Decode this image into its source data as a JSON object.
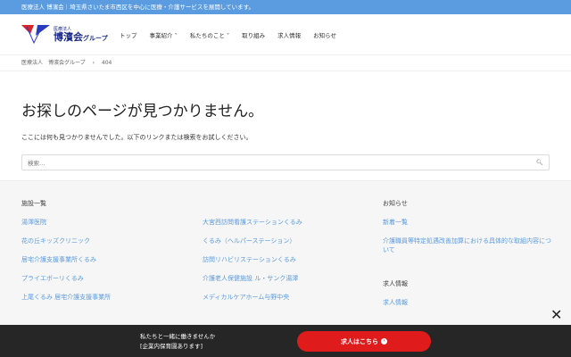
{
  "topbar": "医療法人 博濱会｜埼玉県さいたま市西区を中心に医療・介護サービスを展開しています。",
  "logo": {
    "small": "医療法人",
    "main": "博濱会",
    "suffix": "グループ"
  },
  "nav": [
    "トップ",
    "事業紹介",
    "私たちのこと",
    "取り組み",
    "求人情報",
    "お知らせ"
  ],
  "breadcrumb": {
    "home": "医療法人　博濱会グループ",
    "sep": "›",
    "current": "404"
  },
  "title": "お探しのページが見つかりません。",
  "message": "ここには何も見つかりませんでした。以下のリンクまたは検索をお試しください。",
  "search": {
    "placeholder": "検索…"
  },
  "footer": {
    "facilities_heading": "施設一覧",
    "col1": [
      "湯澤医院",
      "花の丘キッズクリニック",
      "居宅介護支援事業所くるみ",
      "プライエボーリくるみ",
      "上尾くるみ 居宅介護支援事業所"
    ],
    "col2": [
      "大宮西訪問看護ステーションくるみ",
      "くるみ（ヘルパーステーション）",
      "訪問リハビリステーションくるみ",
      "介護老人保健施設 ル・サンク湯澤",
      "メディカルケアホーム与野中央"
    ],
    "news_heading": "お知らせ",
    "news": [
      "新着一覧",
      "介護職員等特定処遇改善加算における具体的な取組内容について"
    ],
    "jobs_heading": "求人情報",
    "jobs": [
      "求人情報"
    ]
  },
  "banner": {
    "line1": "私たちと一緒に働きませんか",
    "line2": "[企業内保育園あります]",
    "cta": "求人はこちら",
    "close": "✕"
  }
}
